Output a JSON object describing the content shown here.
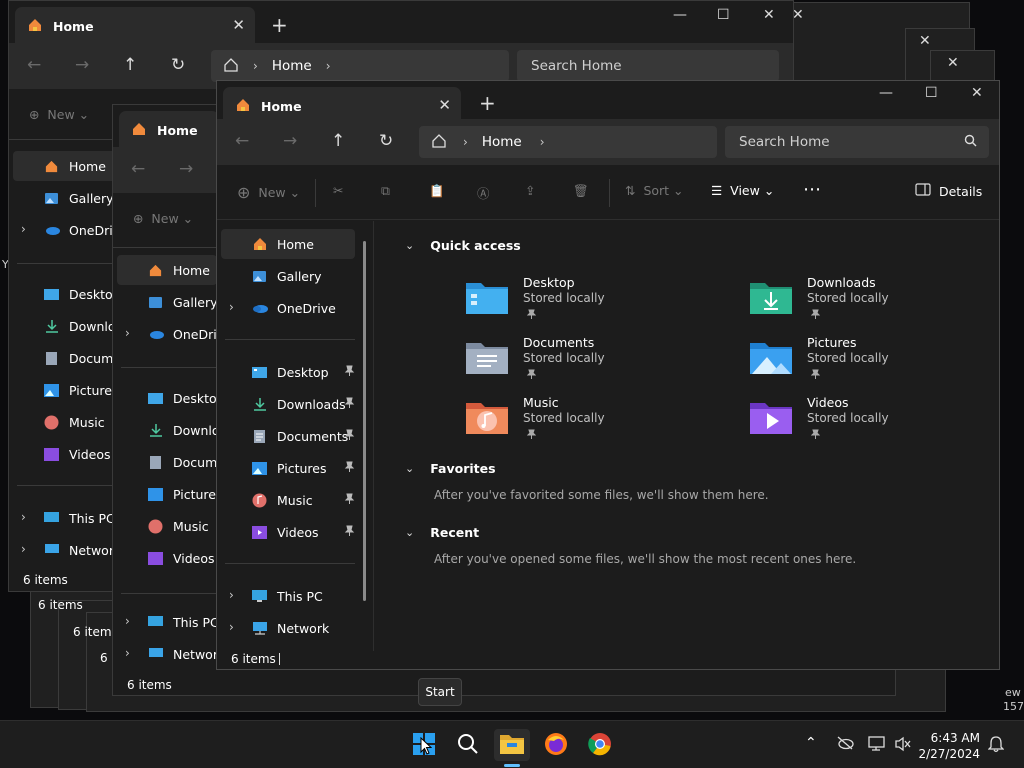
{
  "window": {
    "tab_title": "Home",
    "breadcrumb_home": "Home",
    "search_placeholder": "Search Home"
  },
  "toolbar": {
    "new_label": "New",
    "sort_label": "Sort",
    "view_label": "View",
    "details_label": "Details"
  },
  "sidebar": {
    "home": "Home",
    "gallery": "Gallery",
    "onedrive": "OneDrive",
    "desktop": "Desktop",
    "downloads": "Downloads",
    "documents": "Documents",
    "pictures": "Pictures",
    "music": "Music",
    "videos": "Videos",
    "this_pc": "This PC",
    "network": "Network"
  },
  "bg_sidebar": {
    "downloads_cut": "Download",
    "documents_cut": "Documen"
  },
  "status": {
    "items": "6 items"
  },
  "main": {
    "quick_access": "Quick access",
    "favorites": "Favorites",
    "favorites_hint": "After you've favorited some files, we'll show them here.",
    "recent": "Recent",
    "recent_hint": "After you've opened some files, we'll show the most recent ones here.",
    "stored_locally": "Stored locally",
    "folders": [
      "Desktop",
      "Downloads",
      "Documents",
      "Pictures",
      "Music",
      "Videos"
    ]
  },
  "taskbar": {
    "tooltip": "Start",
    "time": "6:43 AM",
    "date": "2/27/2024"
  },
  "edge_text": {
    "right1": "ew",
    "right2": "157",
    "left1": "Y"
  },
  "colors": {
    "accent": "#4cc2ff",
    "folder_yellow": "#f4c542"
  }
}
